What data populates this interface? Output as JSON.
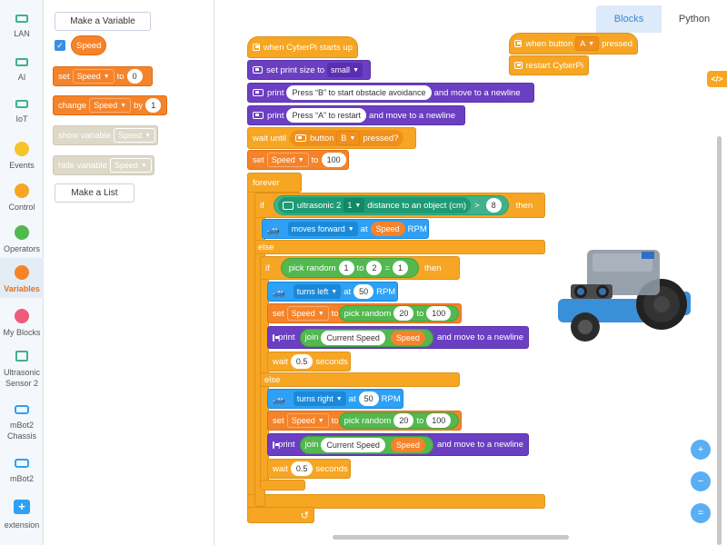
{
  "rail": {
    "items": [
      {
        "label": "LAN",
        "color": "#3fb28a",
        "kind": "square"
      },
      {
        "label": "AI",
        "color": "#3fb28a",
        "kind": "square"
      },
      {
        "label": "IoT",
        "color": "#3fb28a",
        "kind": "square"
      },
      {
        "label": "Events",
        "color": "#f6c32b",
        "kind": "dot"
      },
      {
        "label": "Control",
        "color": "#f6a623",
        "kind": "dot"
      },
      {
        "label": "Operators",
        "color": "#52b84f",
        "kind": "dot"
      },
      {
        "label": "Variables",
        "color": "#f5832a",
        "kind": "dot"
      },
      {
        "label": "My Blocks",
        "color": "#ee5a7a",
        "kind": "dot"
      },
      {
        "label": "Ultrasonic Sensor 2",
        "color": "#3fb28a",
        "kind": "sensor"
      },
      {
        "label": "mBot2 Chassis",
        "color": "#2ea0f5",
        "kind": "robot"
      },
      {
        "label": "mBot2",
        "color": "#2ea0f5",
        "kind": "robot"
      },
      {
        "label": "extension",
        "color": "#2ea0f5",
        "kind": "plus"
      }
    ]
  },
  "palette": {
    "make_variable": "Make a Variable",
    "variable_name": "Speed",
    "set_label": "set",
    "set_var": "Speed",
    "set_to": "to",
    "set_value": "0",
    "change_label": "change",
    "change_var": "Speed",
    "change_by": "by",
    "change_value": "1",
    "show_label": "show variable",
    "show_var": "Speed",
    "hide_label": "hide variable",
    "hide_var": "Speed",
    "make_list": "Make a List"
  },
  "tabs": {
    "blocks": "Blocks",
    "python": "Python"
  },
  "code_toggle": "</>",
  "script1": {
    "hat": "when CyberPi starts up",
    "print_size_label": "set print size to",
    "print_size_value": "small",
    "print1_label": "print",
    "print1_text": "Press “B” to start obstacle avoidance",
    "print1_tail": "and move to a newline",
    "print2_label": "print",
    "print2_text": "Press “A” to restart",
    "print2_tail": "and move to a newline",
    "wait_until": "wait until",
    "button_label": "button",
    "button_value": "B",
    "pressed": "pressed?",
    "set_label": "set",
    "set_var": "Speed",
    "set_to": "to",
    "set_value": "100",
    "forever": "forever",
    "if1": "if",
    "then1": "then",
    "ultra_label": "ultrasonic 2",
    "ultra_port": "1",
    "ultra_tail": "distance to an object (cm)",
    "gt": ">",
    "ultra_value": "8",
    "moves_label": "moves forward",
    "moves_at": "at",
    "moves_var": "Speed",
    "moves_unit": "RPM",
    "else1": "else",
    "if2": "if",
    "then2": "then",
    "pick_label": "pick random",
    "pick_from": "1",
    "pick_to": "to",
    "pick_to_val": "2",
    "eq": "=",
    "eq_val": "1",
    "turn_left": "turns left",
    "turn_left_at": "at",
    "turn_left_val": "50",
    "turn_left_unit": "RPM",
    "set2_label": "set",
    "set2_var": "Speed",
    "set2_to": "to",
    "rand2_label": "pick random",
    "rand2_from": "20",
    "rand2_to": "to",
    "rand2_to_val": "100",
    "print3_label": "print",
    "join3": "join",
    "join3_text": "Current Speed",
    "join3_var": "Speed",
    "print3_tail": "and move to a newline",
    "wait3": "wait",
    "wait3_val": "0.5",
    "wait3_unit": "seconds",
    "else2": "else",
    "turn_right": "turns right",
    "turn_right_at": "at",
    "turn_right_val": "50",
    "turn_right_unit": "RPM",
    "set3_label": "set",
    "set3_var": "Speed",
    "set3_to": "to",
    "rand3_label": "pick random",
    "rand3_from": "20",
    "rand3_to": "to",
    "rand3_to_val": "100",
    "print4_label": "print",
    "join4": "join",
    "join4_text": "Current Speed",
    "join4_var": "Speed",
    "print4_tail": "and move to a newline",
    "wait4": "wait",
    "wait4_val": "0.5",
    "wait4_unit": "seconds",
    "loop_icon": "↺"
  },
  "script2": {
    "hat": "when button",
    "button_value": "A",
    "pressed": "pressed",
    "restart": "restart CyberPi"
  },
  "zoom": {
    "in": "+",
    "out": "−",
    "reset": "="
  }
}
